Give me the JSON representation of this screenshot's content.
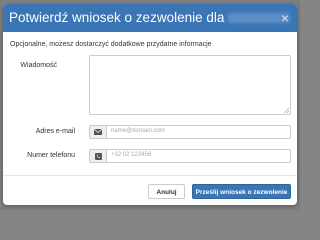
{
  "modal": {
    "title": "Potwierdź wniosek o zezwolenie dla",
    "close_label": "×",
    "intro": "Opcjonalne, możesz dostarczyć dodatkowe przydatne informacje"
  },
  "form": {
    "message": {
      "label": "Wiadomość",
      "value": ""
    },
    "email": {
      "label": "Adres e-mail",
      "placeholder": "name@domain.com",
      "icon": "envelope-icon"
    },
    "phone": {
      "label": "Numer telefonu",
      "placeholder": "+32 02 123456",
      "icon": "phone-icon"
    }
  },
  "buttons": {
    "cancel": "Anuluj",
    "submit": "Prześlij wniosek o zezwolenie"
  },
  "colors": {
    "accent": "#3a75b5",
    "backdrop": "#7f7f7f"
  }
}
